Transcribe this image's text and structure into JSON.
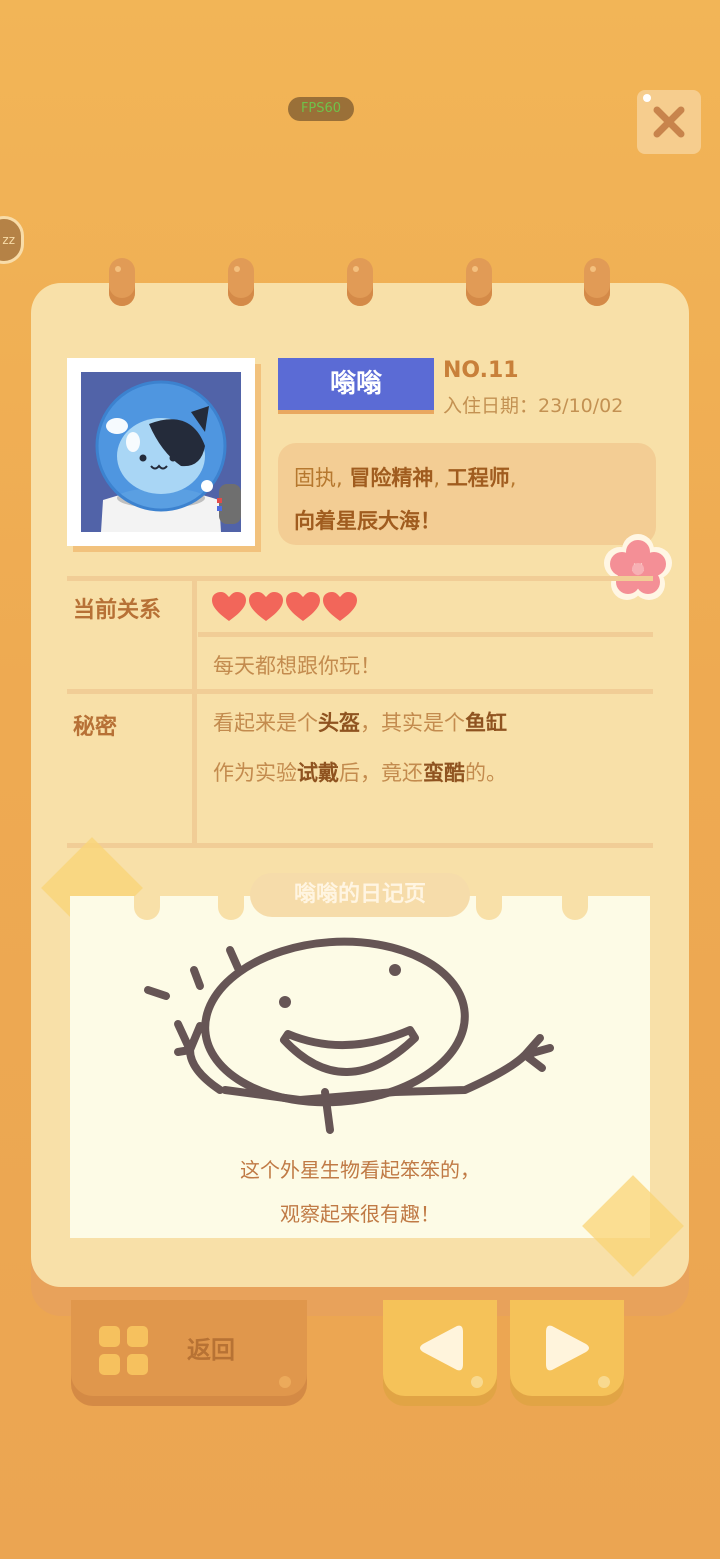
{
  "fps_label": "FPS60",
  "zz_label": "zz",
  "profile": {
    "name": "嗡嗡",
    "number": "NO.11",
    "join_date": "入住日期：23/10/02",
    "traits_line1": [
      "固执",
      "冒险精神",
      "工程师"
    ],
    "traits_line2": "向着星辰大海！"
  },
  "relation": {
    "label": "当前关系",
    "hearts": 4,
    "quote": "每天都想跟你玩！"
  },
  "secret": {
    "label": "秘密",
    "line1": {
      "a": "看起来是个",
      "b": "头盔",
      "c": "，其实是个",
      "d": "鱼缸"
    },
    "line2": {
      "a": "作为实验",
      "b": "试戴",
      "c": "后，竟还",
      "d": "蛮酷",
      "e": "的。"
    }
  },
  "diary": {
    "title": "嗡嗡的日记页",
    "caption1": "这个外星生物看起笨笨的，",
    "caption2": "观察起来很有趣！"
  },
  "buttons": {
    "back": "返回"
  },
  "colors": {
    "name_tag": "#5b6bd5",
    "heart": "#f2665a",
    "card": "#f8e0a8",
    "diary": "#fdfbe6"
  }
}
